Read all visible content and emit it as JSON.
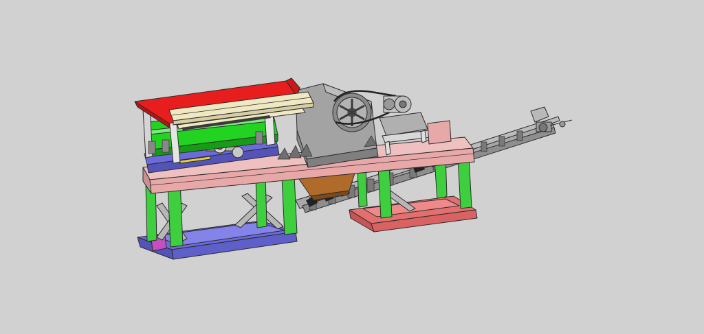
{
  "scene": {
    "background_color": "#d1d1d1",
    "subject": "mobile-jaw-crusher-plant-cad-model"
  },
  "colors": {
    "hopper": "#e81d1d",
    "hopper_frame": "#efe8c2",
    "screen_deck": "#22d322",
    "support_legs": "#3ecf3e",
    "main_beam": "#e8a8a8",
    "pontoon_left": "#6b6bdb",
    "pontoon_right": "#e46f6f",
    "magenta_housing": "#cf3fcf",
    "crusher_body": "#9a9a9a",
    "discharge_chute": "#b06a2a",
    "conveyor_frame": "#a9a9a9",
    "motor": "#bdbdbd",
    "yellow_rail": "#e8d23a"
  },
  "components": [
    {
      "name": "feed-hopper"
    },
    {
      "name": "vibrating-screen"
    },
    {
      "name": "jaw-crusher"
    },
    {
      "name": "flywheel"
    },
    {
      "name": "drive-motor"
    },
    {
      "name": "drive-belt"
    },
    {
      "name": "main-frame-beam"
    },
    {
      "name": "support-legs"
    },
    {
      "name": "left-pontoon"
    },
    {
      "name": "right-pontoon"
    },
    {
      "name": "discharge-chute"
    },
    {
      "name": "belt-conveyor"
    },
    {
      "name": "conveyor-tail-drum"
    }
  ]
}
